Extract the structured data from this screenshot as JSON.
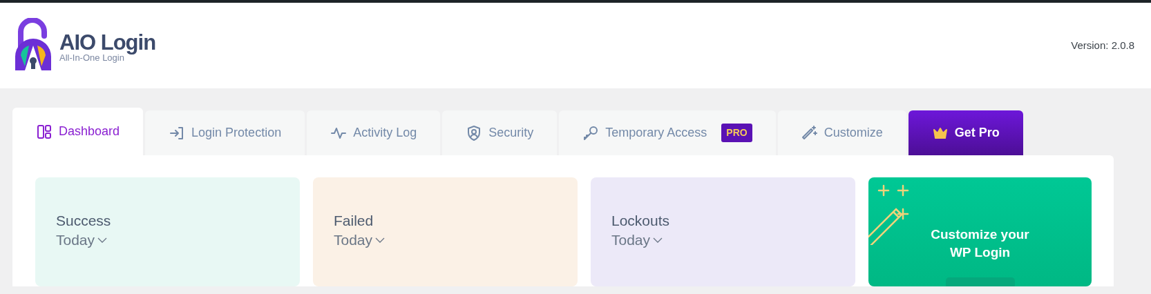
{
  "header": {
    "logo_title": "AIO Login",
    "logo_subtitle": "All-In-One Login",
    "version": "Version: 2.0.8"
  },
  "tabs": [
    {
      "label": "Dashboard",
      "kind": "regular",
      "selected": true
    },
    {
      "label": "Login Protection",
      "kind": "regular",
      "selected": false
    },
    {
      "label": "Activity Log",
      "kind": "regular",
      "selected": false
    },
    {
      "label": "Security",
      "kind": "regular",
      "selected": false
    },
    {
      "label": "Temporary Access",
      "kind": "pro",
      "badge": "PRO",
      "selected": false
    },
    {
      "label": "Customize",
      "kind": "regular",
      "selected": false
    },
    {
      "label": "Get Pro",
      "kind": "upgrade",
      "selected": false
    }
  ],
  "stat_cards": [
    {
      "title": "Success",
      "period": "Today",
      "color": "#e8f8f4"
    },
    {
      "title": "Failed",
      "period": "Today",
      "color": "#fbf1e6"
    },
    {
      "title": "Lockouts",
      "period": "Today",
      "color": "#ece9f8"
    }
  ],
  "promo_card": {
    "title": "Customize your WP Login"
  }
}
